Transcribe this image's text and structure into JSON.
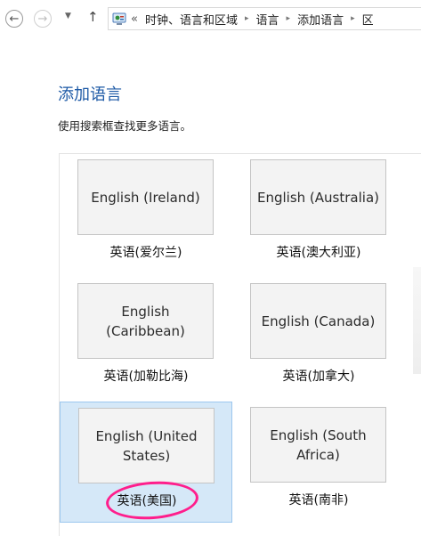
{
  "navbar": {
    "back_glyph": "←",
    "forward_glyph": "→",
    "recent_glyph": "▼",
    "up_glyph": "↑",
    "overflow_glyph": "«",
    "breadcrumb": [
      "时钟、语言和区域",
      "语言",
      "添加语言",
      "区"
    ],
    "separator_glyph": "▸",
    "address_icon": "control-panel-icon"
  },
  "page": {
    "title": "添加语言",
    "instructions": "使用搜索框查找更多语言。"
  },
  "languages": [
    {
      "tile": "English (Ireland)",
      "name": "英语(爱尔兰)",
      "selected": false
    },
    {
      "tile": "English (Australia)",
      "name": "英语(澳大利亚)",
      "selected": false
    },
    {
      "tile": "English (Caribbean)",
      "name": "英语(加勒比海)",
      "selected": false
    },
    {
      "tile": "English (Canada)",
      "name": "英语(加拿大)",
      "selected": false
    },
    {
      "tile": "English (United States)",
      "name": "英语(美国)",
      "selected": true
    },
    {
      "tile": "English (South Africa)",
      "name": "英语(南非)",
      "selected": false
    }
  ],
  "colors": {
    "title": "#1e5aa6",
    "selection_fill": "#d5e8f8",
    "selection_border": "#9cc7ee",
    "highlight_annotation": "#ff1e8c"
  }
}
